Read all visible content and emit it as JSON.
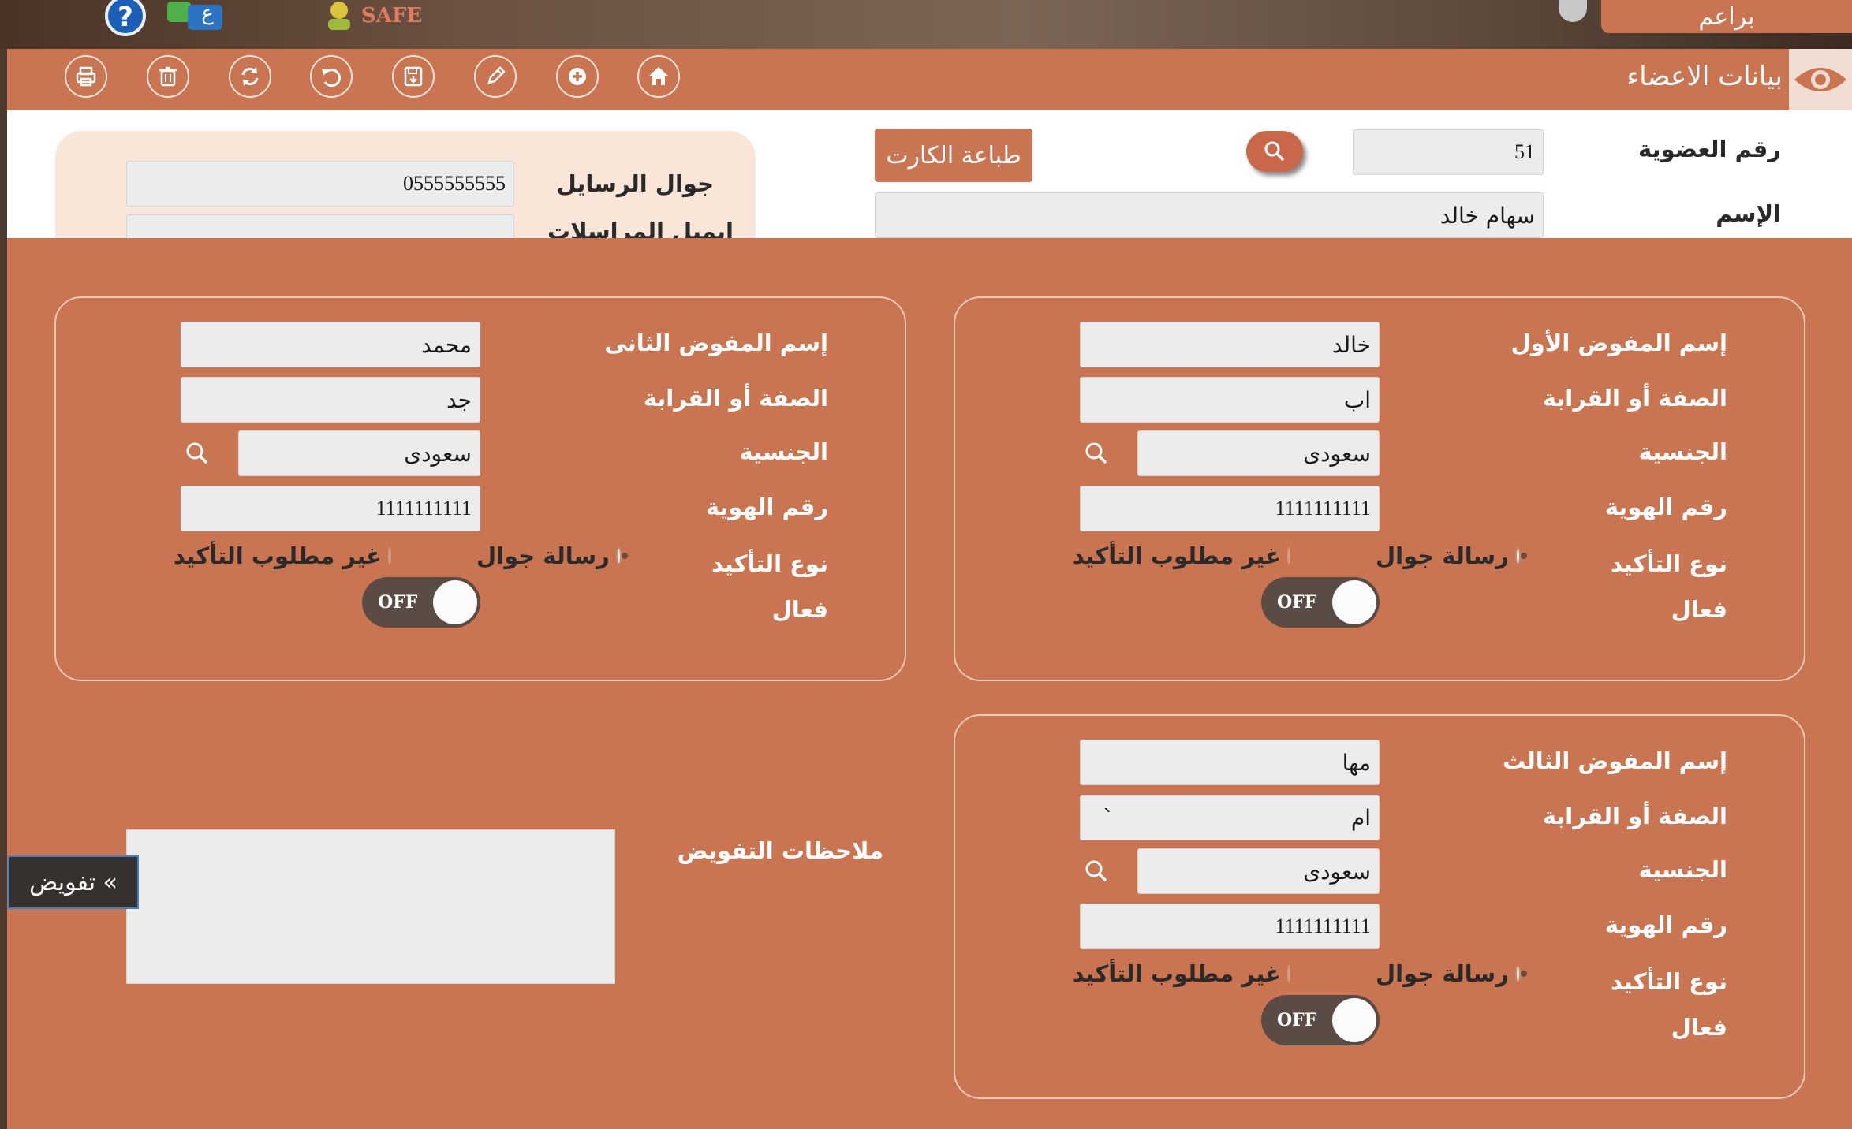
{
  "top_bar": {
    "tab_label": "براعم",
    "safe_label": "SAFE",
    "lang_icon_text": "ع"
  },
  "header": {
    "title": "بيانات الاعضاء"
  },
  "toolbar": {
    "buttons": [
      "print-icon",
      "delete-icon",
      "refresh-icon",
      "undo-icon",
      "save-icon",
      "edit-icon",
      "add-icon",
      "home-icon"
    ]
  },
  "member": {
    "id_label": "رقم العضوية",
    "id_value": "51",
    "name_label": "الإسم",
    "name_value": "سهام خالد",
    "print_card_label": "طباعة الكارت",
    "sms_mobile_label": "جوال الرسايل",
    "sms_mobile_value": "0555555555",
    "email_label": "ايميل المراسلات"
  },
  "delegate1": {
    "name_label": "إسم المفوض الأول",
    "name_value": "خالد",
    "relation_label": "الصفة أو القرابة",
    "relation_value": "اب",
    "nationality_label": "الجنسية",
    "nationality_value": "سعودى",
    "id_label": "رقم الهوية",
    "id_value": "1111111111",
    "confirm_label": "نوع التأكيد",
    "opt_sms": "رسالة جوال",
    "opt_none": "غير مطلوب التأكيد",
    "active_label": "فعال",
    "toggle_text": "OFF"
  },
  "delegate2": {
    "name_label": "إسم المفوض الثانى",
    "name_value": "محمد",
    "relation_label": "الصفة أو القرابة",
    "relation_value": "جد",
    "nationality_label": "الجنسية",
    "nationality_value": "سعودى",
    "id_label": "رقم الهوية",
    "id_value": "1111111111",
    "confirm_label": "نوع التأكيد",
    "opt_sms": "رسالة جوال",
    "opt_none": "غير مطلوب التأكيد",
    "active_label": "فعال",
    "toggle_text": "OFF"
  },
  "delegate3": {
    "name_label": "إسم المفوض الثالث",
    "name_value": "مها",
    "relation_label": "الصفة أو القرابة",
    "relation_value": "ام",
    "relation_extra": "`",
    "nationality_label": "الجنسية",
    "nationality_value": "سعودى",
    "id_label": "رقم الهوية",
    "id_value": "1111111111",
    "confirm_label": "نوع التأكيد",
    "opt_sms": "رسالة جوال",
    "opt_none": "غير مطلوب التأكيد",
    "active_label": "فعال",
    "toggle_text": "OFF"
  },
  "notes": {
    "label": "ملاحظات التفويض",
    "value": ""
  },
  "side_tab": {
    "label": "» تفويض"
  }
}
